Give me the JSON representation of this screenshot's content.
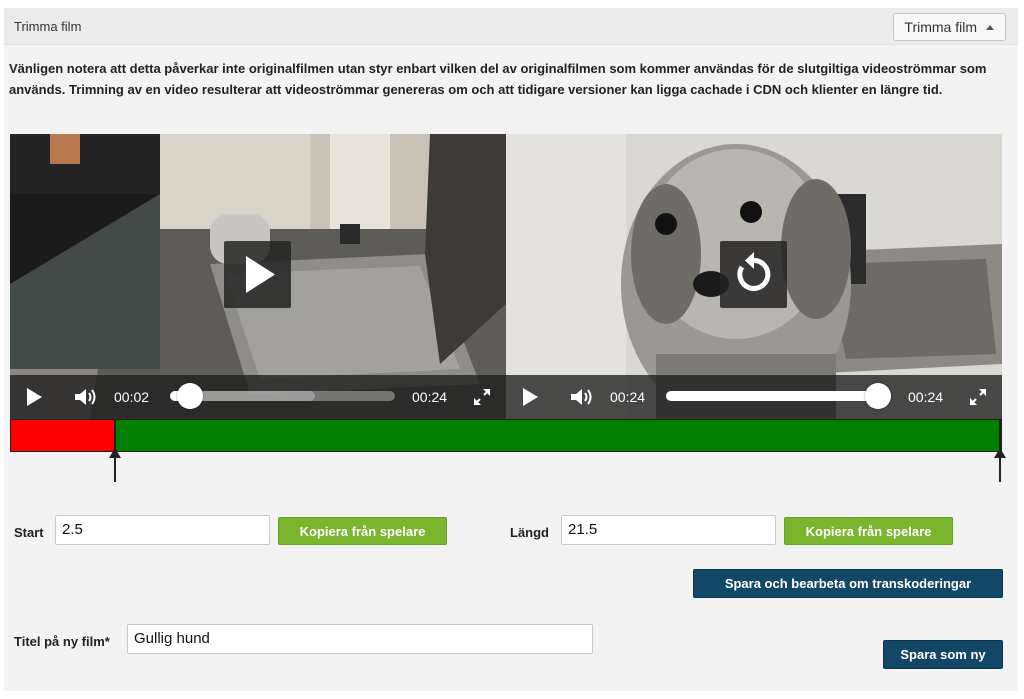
{
  "header": {
    "title": "Trimma film",
    "toggle_label": "Trimma film"
  },
  "notice": "Vänligen notera att detta påverkar inte originalfilmen utan styr enbart vilken del av originalfilmen som kommer användas för de slutgiltiga videoströmmar som används. Trimning av en video resulterar att videoströmmar genereras om och att tidigare versioner kan ligga cachade i CDN och klienter en längre tid.",
  "players": [
    {
      "current_time": "00:02",
      "duration": "00:24",
      "progress": 0.09,
      "big_button": "play-icon"
    },
    {
      "current_time": "00:24",
      "duration": "00:24",
      "progress": 1.0,
      "big_button": "replay-icon"
    }
  ],
  "range": {
    "start_fraction": 0.105,
    "end_fraction": 1.0,
    "trimmed_color": "#ff0000",
    "kept_color": "#008000"
  },
  "form": {
    "start_label": "Start",
    "start_value": "2.5",
    "copy_start_label": "Kopiera från spelare",
    "length_label": "Längd",
    "length_value": "21.5",
    "copy_length_label": "Kopiera från spelare",
    "save_reprocess_label": "Spara och bearbeta om transkoderingar",
    "title_label": "Titel på ny film*",
    "title_value": "Gullig hund",
    "save_new_label": "Spara som ny"
  },
  "colors": {
    "green_button": "#7ab52e",
    "navy_button": "#124866",
    "panel_bg": "#f3f3f3"
  }
}
